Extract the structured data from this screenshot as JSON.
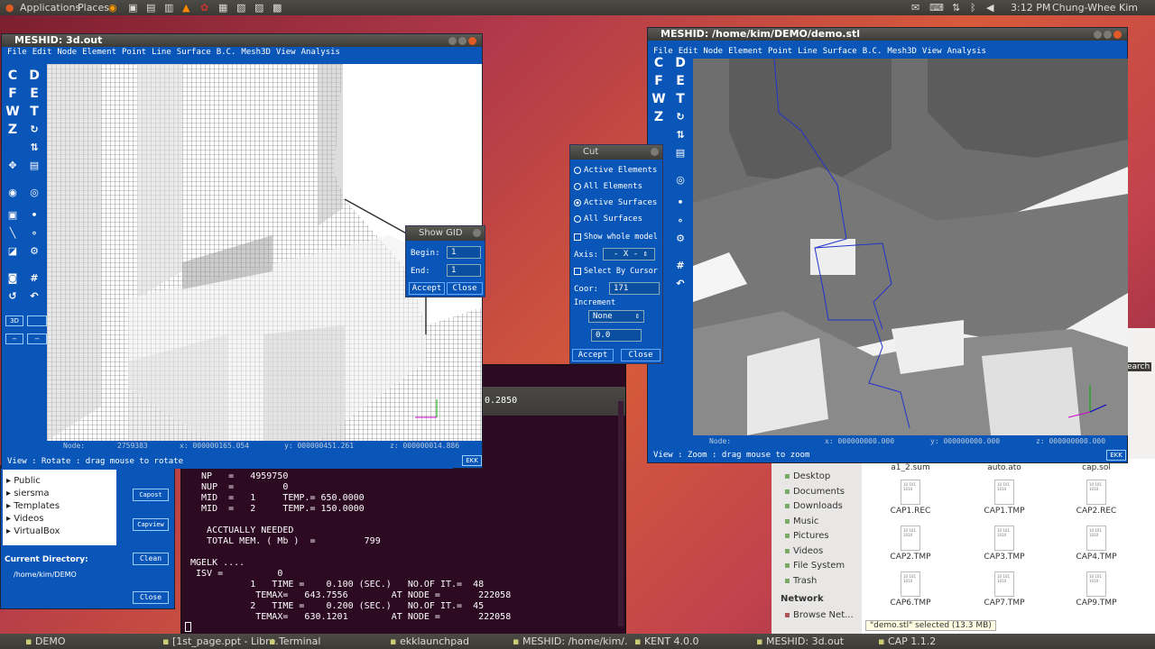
{
  "top_panel": {
    "applications": "Applications",
    "places": "Places",
    "time": "3:12 PM",
    "user": "Chung-Whee Kim"
  },
  "meshid_left": {
    "title": "MESHID: 3d.out",
    "menu": [
      "File",
      "Edit",
      "Node",
      "Element",
      "Point",
      "Line",
      "Surface",
      "B.C.",
      "Mesh3D",
      "View",
      "Analysis"
    ],
    "tools": [
      "C",
      "D",
      "F",
      "E",
      "W",
      "T",
      "Z"
    ],
    "status": {
      "node": "Node:",
      "node_val": "2759383",
      "x": "x: 000000165.054",
      "y": "y: 000000451.261",
      "z": "z: 000000014.886"
    },
    "view_text": "View : Rotate : drag mouse to rotate",
    "ekk": "EKK",
    "mode": "3D"
  },
  "meshid_right": {
    "title": "MESHID: /home/kim/DEMO/demo.stl",
    "menu": [
      "File",
      "Edit",
      "Node",
      "Element",
      "Point",
      "Line",
      "Surface",
      "B.C.",
      "Mesh3D",
      "View",
      "Analysis"
    ],
    "tools": [
      "C",
      "D",
      "F",
      "E",
      "W",
      "T",
      "Z"
    ],
    "status": {
      "node": "Node:",
      "x": "x: 000000000.000",
      "y": "y: 000000000.000",
      "z": "z: 000000000.000"
    },
    "view_text": "View : Zoom : drag mouse to zoom",
    "ekk": "EKK"
  },
  "show_gid": {
    "title": "Show GID",
    "begin_label": "Begin:",
    "begin_val": "1",
    "end_label": "End:",
    "end_val": "1",
    "accept": "Accept",
    "close": "Close"
  },
  "cut": {
    "title": "Cut",
    "radios": [
      "Active Elements",
      "All Elements",
      "Active Surfaces",
      "All Surfaces"
    ],
    "selected_radio": 2,
    "show_whole": "Show whole model",
    "axis_label": "Axis:",
    "axis_val": "- X -",
    "select_cursor": "Select By Cursor",
    "coor_label": "Coor:",
    "coor_val": "171",
    "increment_label": "Increment",
    "increment_val": "None",
    "inc_field": "0.0",
    "accept": "Accept",
    "close": "Close"
  },
  "terminal": {
    "partial": "0.2850",
    "lines": [
      "  NP   =   4959750",
      "  NUP  =         0",
      "  MID  =   1     TEMP.= 650.0000",
      "  MID  =   2     TEMP.= 150.0000",
      "",
      "   ACCTUALLY NEEDED",
      "   TOTAL MEM. ( Mb )  =         799",
      "",
      "MGELK ....",
      " ISV =          0",
      "           1   TIME =    0.100 (SEC.)   NO.OF IT.=  48",
      "            TEMAX=   643.7556        AT NODE =       222058",
      "           2   TIME =    0.200 (SEC.)   NO.OF IT.=  45",
      "            TEMAX=   630.1201        AT NODE =       222058"
    ]
  },
  "cap_panel": {
    "tree": [
      "Public",
      "siersma",
      "Templates",
      "Videos",
      "VirtualBox"
    ],
    "capost": "Capost",
    "capview": "Capview",
    "current_dir_label": "Current Directory:",
    "current_dir": "/home/kim/DEMO",
    "clean": "Clean",
    "close": "Close"
  },
  "file_manager": {
    "sidebar": [
      "Desktop",
      "Documents",
      "Downloads",
      "Music",
      "Pictures",
      "Videos",
      "File System",
      "Trash"
    ],
    "network": "Network",
    "browse": "Browse Net...",
    "search": "earch",
    "top_files": [
      "a1_2.sum",
      "auto.ato",
      "cap.sol"
    ],
    "files": [
      "CAP1.REC",
      "CAP1.TMP",
      "CAP2.REC",
      "CAP2.TMP",
      "CAP3.TMP",
      "CAP4.TMP",
      "CAP6.TMP",
      "CAP7.TMP",
      "CAP9.TMP"
    ],
    "status": "\"demo.stl\" selected (13.3 MB)"
  },
  "taskbar": [
    "DEMO",
    "[1st_page.ppt - Libre...",
    "Terminal",
    "ekklaunchpad",
    "MESHID: /home/kim/...",
    "KENT 4.0.0",
    "MESHID: 3d.out",
    "CAP 1.1.2"
  ]
}
